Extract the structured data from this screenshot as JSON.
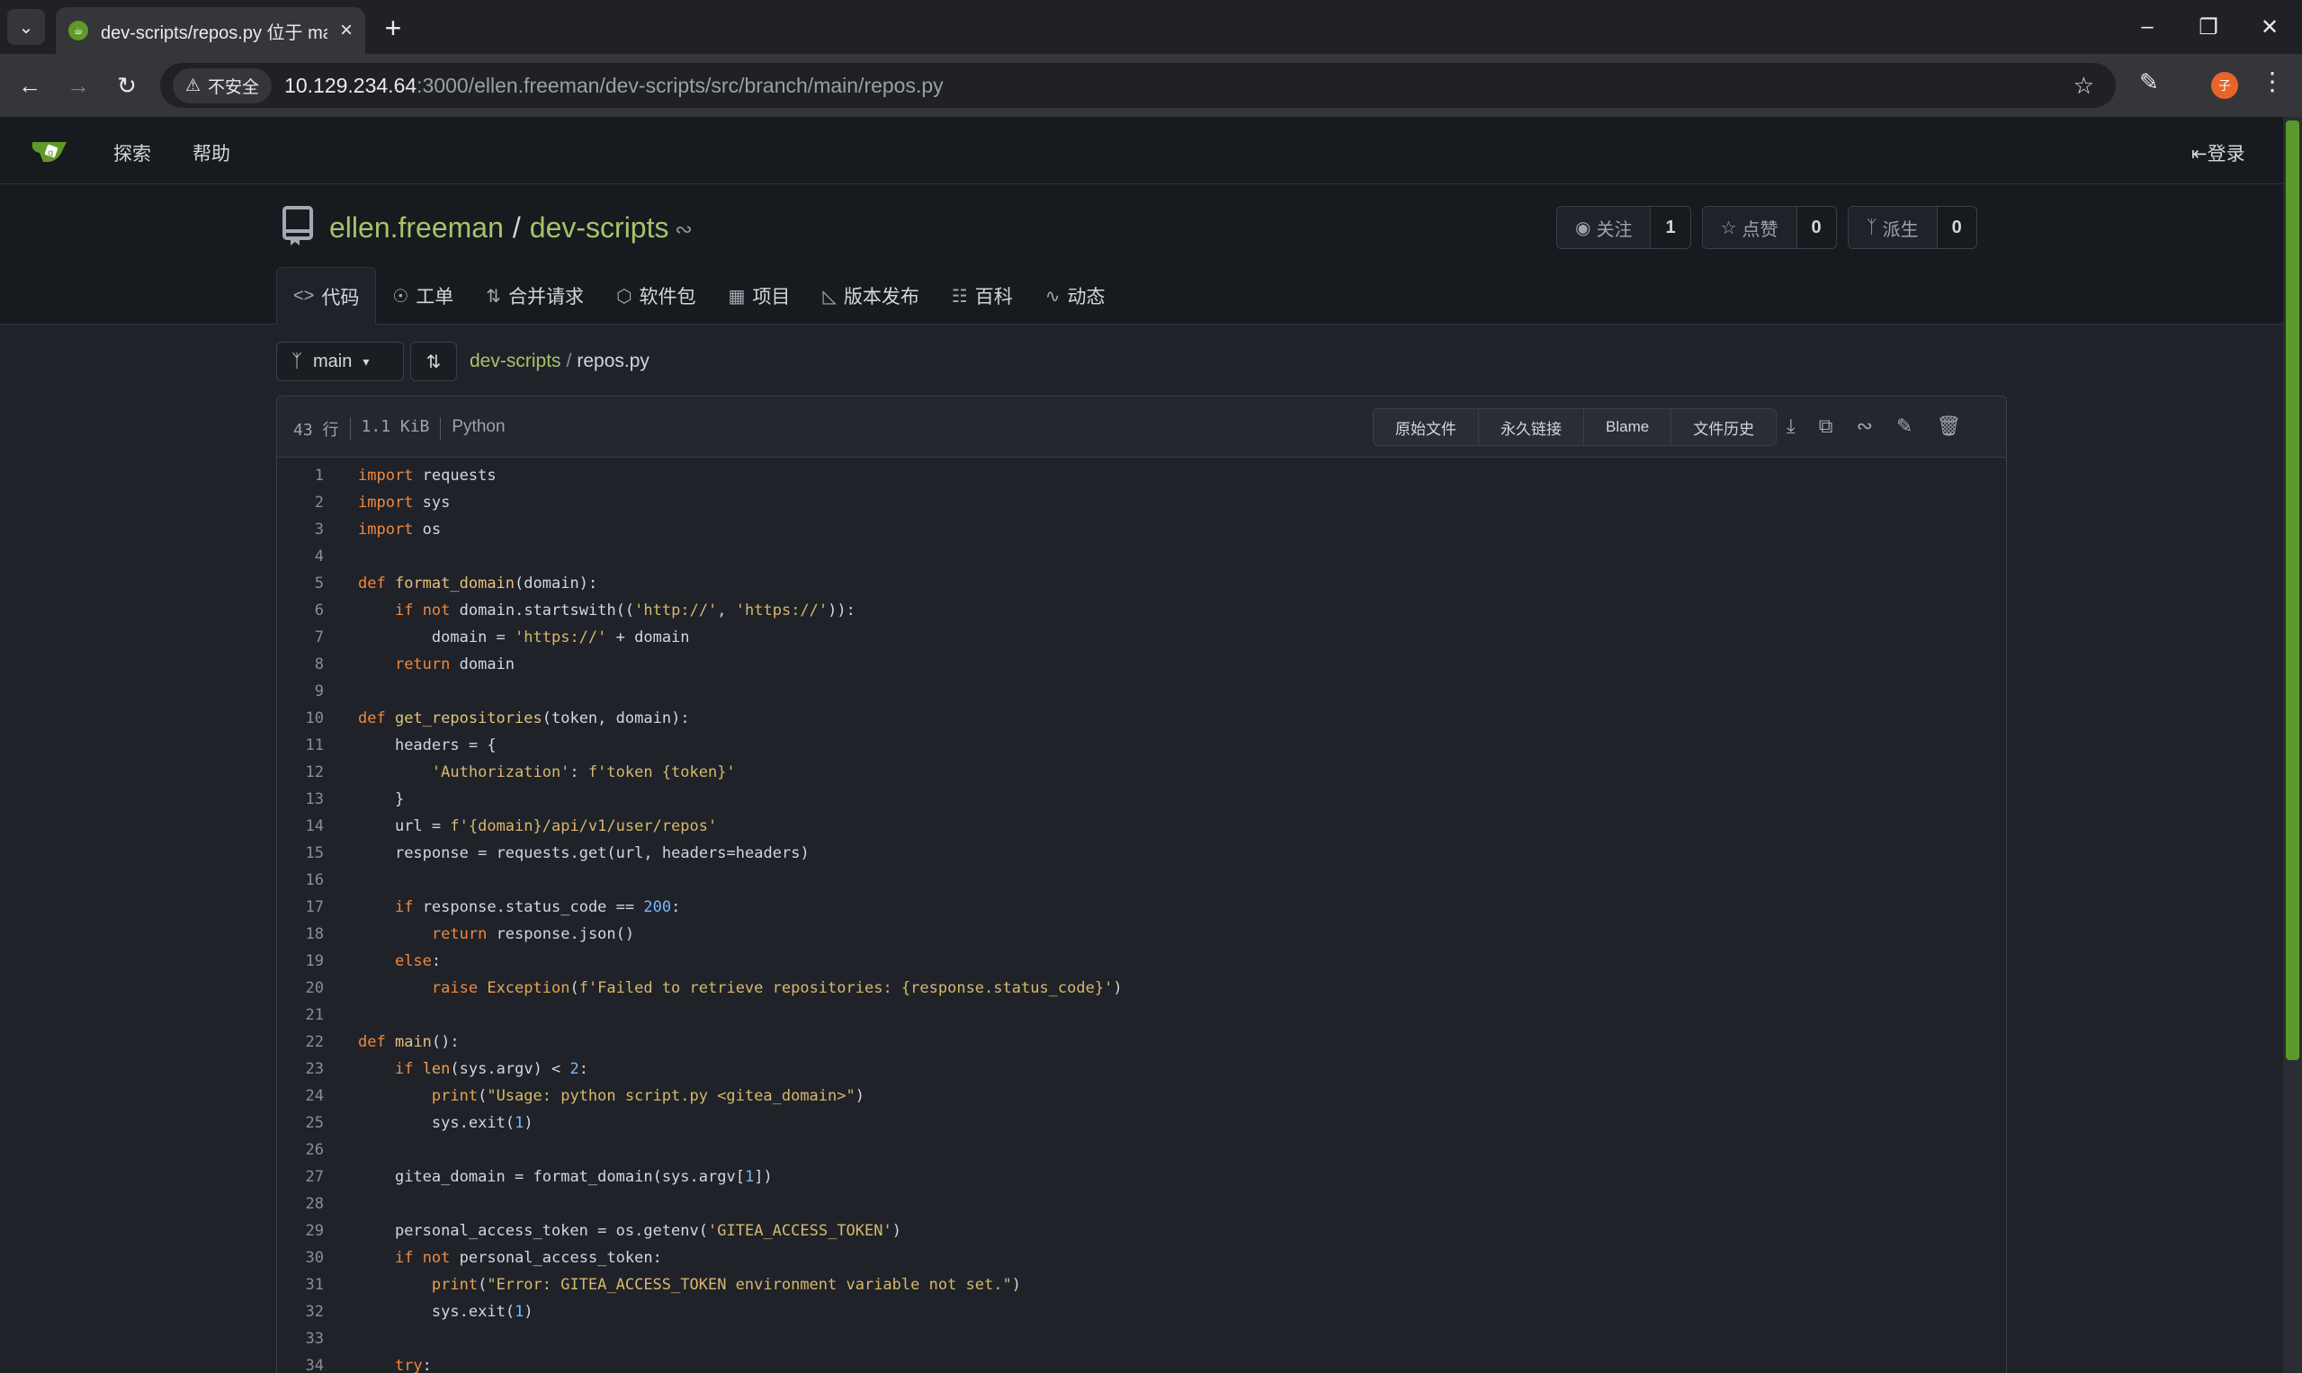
{
  "browser": {
    "tab_title": "dev-scripts/repos.py 位于 main",
    "security_label": "不安全",
    "url_host": "10.129.234.64",
    "url_rest": ":3000/ellen.freeman/dev-scripts/src/branch/main/repos.py",
    "profile_initial": "子"
  },
  "gitea_nav": {
    "explore": "探索",
    "help": "帮助",
    "sign_in": "登录"
  },
  "repo": {
    "owner": "ellen.freeman",
    "separator": "/",
    "name": "dev-scripts",
    "watch_label": "关注",
    "watch_count": "1",
    "star_label": "点赞",
    "star_count": "0",
    "fork_label": "派生",
    "fork_count": "0",
    "tabs": [
      {
        "label": "代码",
        "icon": "code-icon"
      },
      {
        "label": "工单",
        "icon": "issue-icon"
      },
      {
        "label": "合并请求",
        "icon": "pull-request-icon"
      },
      {
        "label": "软件包",
        "icon": "package-icon"
      },
      {
        "label": "项目",
        "icon": "project-icon"
      },
      {
        "label": "版本发布",
        "icon": "tag-icon"
      },
      {
        "label": "百科",
        "icon": "book-icon"
      },
      {
        "label": "动态",
        "icon": "pulse-icon"
      }
    ]
  },
  "branch": {
    "name": "main",
    "crumb_repo": "dev-scripts",
    "crumb_sep": "/",
    "crumb_file": "repos.py"
  },
  "file": {
    "lines_count": "43 行",
    "size": "1.1 KiB",
    "language": "Python",
    "buttons": {
      "raw": "原始文件",
      "permalink": "永久链接",
      "blame": "Blame",
      "history": "文件历史"
    }
  },
  "code_lines": [
    "import requests",
    "import sys",
    "import os",
    "",
    "def format_domain(domain):",
    "    if not domain.startswith(('http://', 'https://')):",
    "        domain = 'https://' + domain",
    "    return domain",
    "",
    "def get_repositories(token, domain):",
    "    headers = {",
    "        'Authorization': f'token {token}'",
    "    }",
    "    url = f'{domain}/api/v1/user/repos'",
    "    response = requests.get(url, headers=headers)",
    "",
    "    if response.status_code == 200:",
    "        return response.json()",
    "    else:",
    "        raise Exception(f'Failed to retrieve repositories: {response.status_code}')",
    "",
    "def main():",
    "    if len(sys.argv) < 2:",
    "        print(\"Usage: python script.py <gitea_domain>\")",
    "        sys.exit(1)",
    "",
    "    gitea_domain = format_domain(sys.argv[1])",
    "",
    "    personal_access_token = os.getenv('GITEA_ACCESS_TOKEN')",
    "    if not personal_access_token:",
    "        print(\"Error: GITEA_ACCESS_TOKEN environment variable not set.\")",
    "        sys.exit(1)",
    "",
    "    try:"
  ],
  "colors": {
    "accent": "#a6c36a",
    "keyword": "#f0883e",
    "function": "#e5c07b",
    "string": "#d8b86a",
    "number": "#79b8ff"
  }
}
